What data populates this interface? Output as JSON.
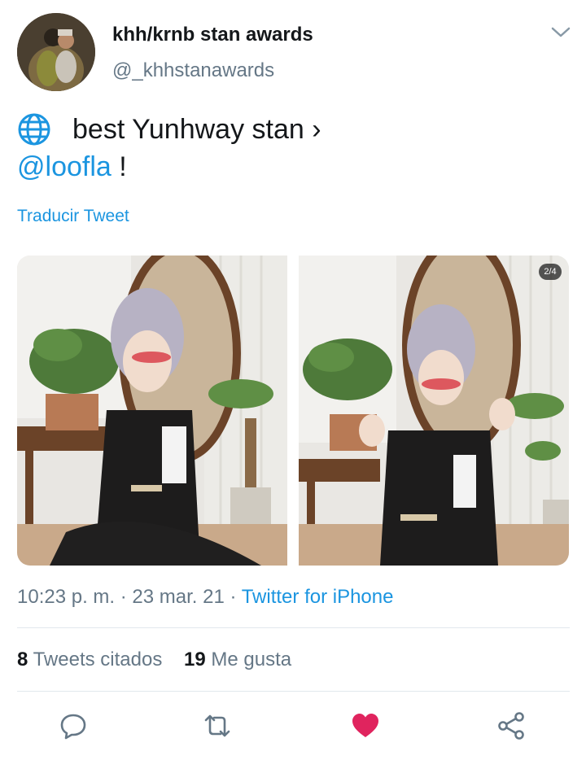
{
  "user": {
    "display_name": "khh/krnb stan awards",
    "handle": "@_khhstanawards"
  },
  "tweet": {
    "line1_text": "best Yunhway stan ›",
    "mention": "@loofla",
    "line2_suffix": " !",
    "translate_label": "Traducir Tweet"
  },
  "media": {
    "counter": "2/4"
  },
  "meta": {
    "time": "10:23 p. m.",
    "separator1": " · ",
    "date": "23 mar. 21",
    "separator2": " · ",
    "source": "Twitter for iPhone"
  },
  "stats": {
    "quotes_count": "8",
    "quotes_label": "Tweets citados",
    "likes_count": "19",
    "likes_label": "Me gusta"
  },
  "colors": {
    "accent": "#1b95e0",
    "like": "#e0245e",
    "secondary_text": "#657786"
  },
  "icons": {
    "more": "chevron-down-icon",
    "globe": "globe-icon",
    "reply": "reply-icon",
    "retweet": "retweet-icon",
    "like": "heart-icon",
    "share": "share-icon"
  }
}
